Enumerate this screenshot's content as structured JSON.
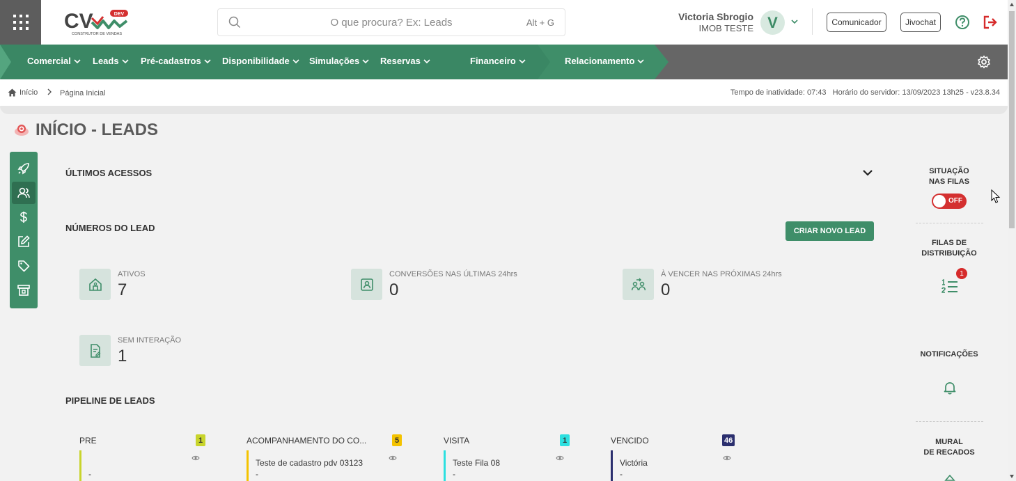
{
  "header": {
    "logo_text": "CV",
    "logo_badge": "DEV",
    "logo_tagline": "CONSTRUTOR DE VENDAS",
    "search_placeholder": "O que procura? Ex: Leads",
    "search_shortcut": "Alt + G",
    "user_name": "Victoria Sbrogio",
    "user_company": "IMOB TESTE",
    "avatar_letter": "V",
    "btn_comunicador": "Comunicador",
    "btn_jivochat": "Jivochat"
  },
  "nav": {
    "items": [
      "Comercial",
      "Leads",
      "Pré-cadastros",
      "Disponibilidade",
      "Simulações",
      "Reservas",
      "Financeiro",
      "Relacionamento"
    ]
  },
  "breadcrumb": {
    "home": "Início",
    "current": "Página Inicial",
    "server_info": "Tempo de inatividade: 07:43   Horário do servidor: 13/09/2023 13h25 - v23.8.34"
  },
  "page": {
    "title": "INÍCIO - LEADS"
  },
  "sections": {
    "ultimos_acessos": "ÚLTIMOS ACESSOS",
    "numeros_lead": "NÚMEROS DO LEAD",
    "new_lead_button": "CRIAR NOVO LEAD",
    "pipeline": "PIPELINE DE LEADS"
  },
  "stats": [
    {
      "label": "ATIVOS",
      "value": "7",
      "icon": "house-icon"
    },
    {
      "label": "CONVERSÕES NAS ÚLTIMAS 24hrs",
      "value": "0",
      "icon": "user-card-icon"
    },
    {
      "label": "À VENCER NAS PRÓXIMAS 24hrs",
      "value": "0",
      "icon": "users-exchange-icon"
    },
    {
      "label": "SEM INTERAÇÃO",
      "value": "1",
      "icon": "document-edit-icon"
    }
  ],
  "pipeline": [
    {
      "name": "PRE",
      "count": "1",
      "color": "#c8d42c",
      "card_title": "",
      "card_sub": "-"
    },
    {
      "name": "ACOMPANHAMENTO DO CO...",
      "count": "5",
      "color": "#f4c300",
      "card_title": "Teste de cadastro pdv 03123",
      "card_sub": "-"
    },
    {
      "name": "VISITA",
      "count": "1",
      "color": "#2de0e0",
      "card_title": "Teste Fila 08",
      "card_sub": "-"
    },
    {
      "name": "VENCIDO",
      "count": "46",
      "color": "#2b2f6e",
      "card_title": "Victória",
      "card_sub": "-"
    }
  ],
  "right_panel": {
    "situacao_l1": "SITUAÇÃO",
    "situacao_l2": "NAS FILAS",
    "toggle_text": "OFF",
    "filas_l1": "FILAS DE",
    "filas_l2": "DISTRIBUIÇÃO",
    "filas_badge": "1",
    "notificacoes": "NOTIFICAÇÕES",
    "mural_l1": "MURAL",
    "mural_l2": "DE RECADOS"
  },
  "colors": {
    "brand_green": "#3f8e69",
    "nav_gray": "#666666",
    "alert_red": "#d43030"
  }
}
